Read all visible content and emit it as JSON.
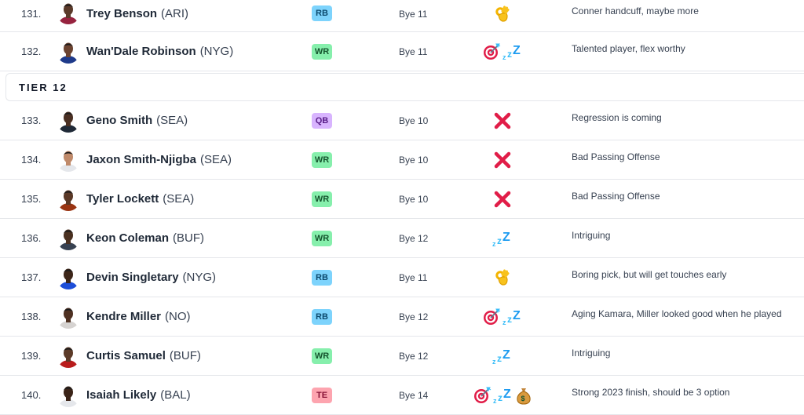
{
  "tier_label": "TIER 12",
  "players": [
    {
      "rank": "131.",
      "name": "Trey Benson",
      "team": "(ARI)",
      "pos": "RB",
      "bye": "Bye 11",
      "icons": [
        "ok-hand-icon"
      ],
      "note": "Conner handcuff, maybe more",
      "skin": "#5b3a2a",
      "jersey": "#97233f"
    },
    {
      "rank": "132.",
      "name": "Wan'Dale Robinson",
      "team": "(NYG)",
      "pos": "WR",
      "bye": "Bye 11",
      "icons": [
        "target-icon",
        "sleeper-icon"
      ],
      "note": "Talented player, flex worthy",
      "skin": "#6b4330",
      "jersey": "#1e3a8a"
    },
    {
      "rank": "133.",
      "name": "Geno Smith",
      "team": "(SEA)",
      "pos": "QB",
      "bye": "Bye 10",
      "icons": [
        "cross-mark-icon"
      ],
      "note": "Regression is coming",
      "skin": "#4a2f22",
      "jersey": "#1f2937"
    },
    {
      "rank": "134.",
      "name": "Jaxon Smith-Njigba",
      "team": "(SEA)",
      "pos": "WR",
      "bye": "Bye 10",
      "icons": [
        "cross-mark-icon"
      ],
      "note": "Bad Passing Offense",
      "skin": "#c08a6a",
      "jersey": "#e5e7eb"
    },
    {
      "rank": "135.",
      "name": "Tyler Lockett",
      "team": "(SEA)",
      "pos": "WR",
      "bye": "Bye 10",
      "icons": [
        "cross-mark-icon"
      ],
      "note": "Bad Passing Offense",
      "skin": "#5a3826",
      "jersey": "#9a3412"
    },
    {
      "rank": "136.",
      "name": "Keon Coleman",
      "team": "(BUF)",
      "pos": "WR",
      "bye": "Bye 12",
      "icons": [
        "sleeper-icon"
      ],
      "note": "Intriguing",
      "skin": "#4a3020",
      "jersey": "#374151"
    },
    {
      "rank": "137.",
      "name": "Devin Singletary",
      "team": "(NYG)",
      "pos": "RB",
      "bye": "Bye 11",
      "icons": [
        "ok-hand-icon"
      ],
      "note": "Boring pick, but will get touches early",
      "skin": "#3d2619",
      "jersey": "#1d4ed8"
    },
    {
      "rank": "138.",
      "name": "Kendre Miller",
      "team": "(NO)",
      "pos": "RB",
      "bye": "Bye 12",
      "icons": [
        "target-icon",
        "sleeper-icon"
      ],
      "note": "Aging Kamara, Miller looked good when he played",
      "skin": "#4f3122",
      "jersey": "#d6d3d1"
    },
    {
      "rank": "139.",
      "name": "Curtis Samuel",
      "team": "(BUF)",
      "pos": "WR",
      "bye": "Bye 12",
      "icons": [
        "sleeper-icon"
      ],
      "note": "Intriguing",
      "skin": "#5c3a28",
      "jersey": "#b91c1c"
    },
    {
      "rank": "140.",
      "name": "Isaiah Likely",
      "team": "(BAL)",
      "pos": "TE",
      "bye": "Bye 14",
      "icons": [
        "target-icon",
        "sleeper-icon",
        "money-bag-icon"
      ],
      "note": "Strong 2023 finish, should be 3 option",
      "skin": "#3b2418",
      "jersey": "#e5e7eb"
    }
  ]
}
